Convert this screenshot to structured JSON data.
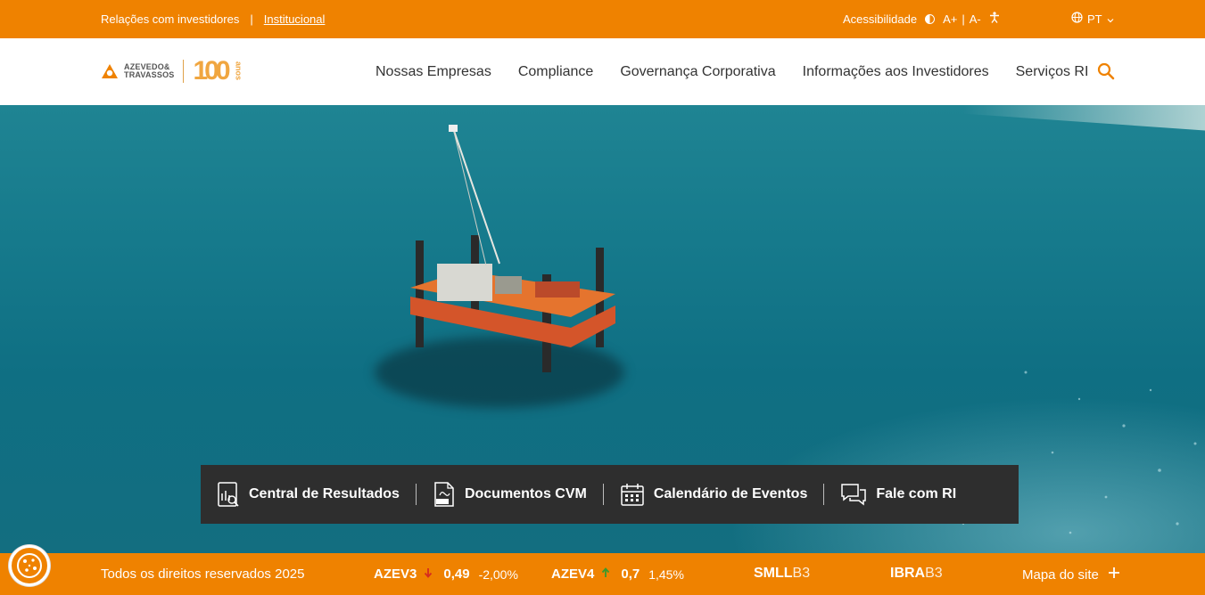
{
  "topbar": {
    "investor_relations": "Relações com investidores",
    "separator": "|",
    "institutional": "Institucional",
    "accessibility": "Acessibilidade",
    "font_increase": "A+",
    "font_sep": "|",
    "font_decrease": "A-",
    "language": "PT"
  },
  "nav": {
    "logo_text_line1": "AZEVEDO&",
    "logo_text_line2": "TRAVASSOS",
    "logo_100": "100",
    "logo_anos": "anos",
    "items": [
      {
        "label": "Nossas Empresas"
      },
      {
        "label": "Compliance"
      },
      {
        "label": "Governança Corporativa"
      },
      {
        "label": "Informações aos Investidores"
      },
      {
        "label": "Serviços RI"
      }
    ]
  },
  "quick_links": [
    {
      "label": "Central de Resultados",
      "icon": "results-report-icon"
    },
    {
      "label": "Documentos CVM",
      "icon": "pdf-document-icon"
    },
    {
      "label": "Calendário de Eventos",
      "icon": "calendar-icon"
    },
    {
      "label": "Fale com RI",
      "icon": "chat-bubbles-icon"
    }
  ],
  "footer": {
    "rights": "Todos os direitos reservados 2025",
    "stocks": [
      {
        "ticker": "AZEV3",
        "price": "0,49",
        "change": "-2,00%",
        "direction": "down",
        "color": "#d62b1f"
      },
      {
        "ticker": "AZEV4",
        "price": "0,7",
        "change": "1,45%",
        "direction": "up",
        "color": "#3a9a2c"
      }
    ],
    "indexes": [
      {
        "name": "SMLL",
        "suffix": "B3"
      },
      {
        "name": "IBRA",
        "suffix": "B3"
      }
    ],
    "sitemap": "Mapa do site",
    "sitemap_icon": "plus-icon"
  },
  "colors": {
    "brand_orange": "#ef8200",
    "quick_bar": "#2e2e2e"
  }
}
